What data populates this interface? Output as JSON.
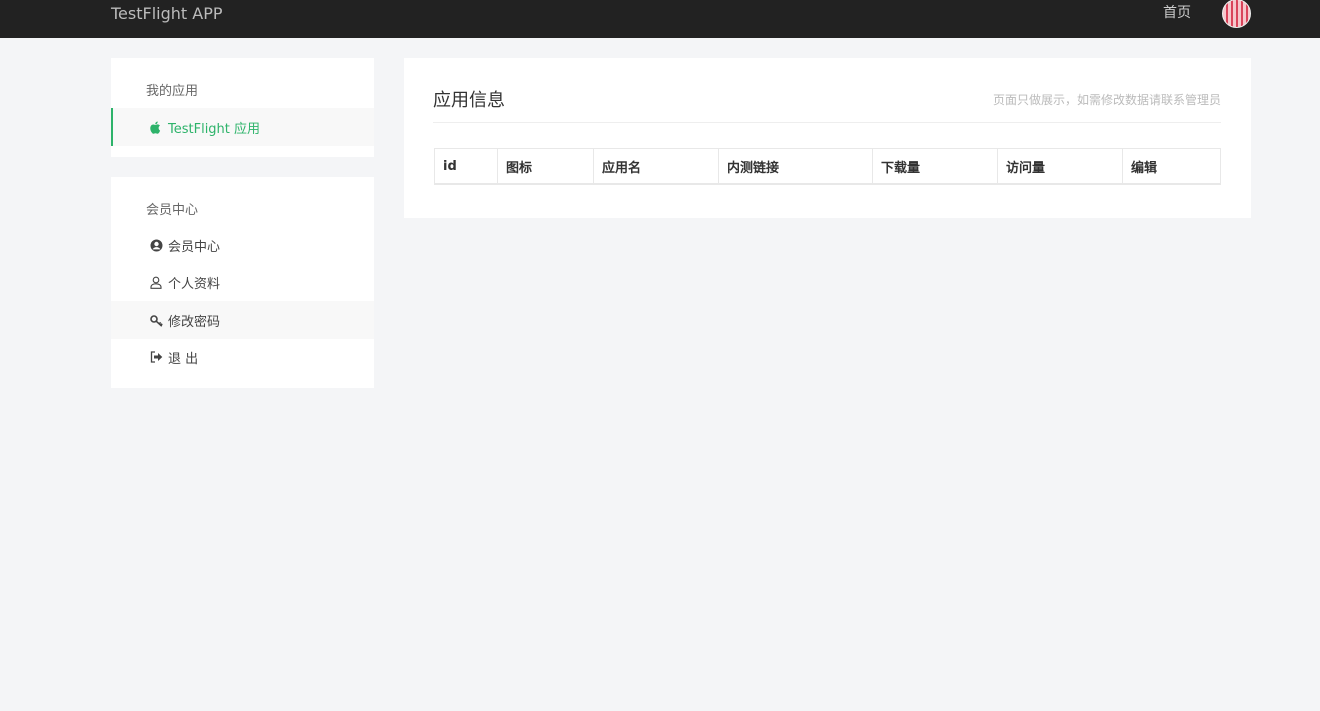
{
  "header": {
    "brand": "TestFlight APP",
    "home_link": "首页"
  },
  "sidebar": {
    "my_apps": {
      "title": "我的应用",
      "items": [
        {
          "label": "TestFlight 应用",
          "icon": "apple-icon"
        }
      ]
    },
    "member_center": {
      "title": "会员中心",
      "items": [
        {
          "label": "会员中心",
          "icon": "user-circle-icon"
        },
        {
          "label": "个人资料",
          "icon": "user-outline-icon"
        },
        {
          "label": "修改密码",
          "icon": "key-icon"
        },
        {
          "label": "退 出",
          "icon": "sign-out-icon"
        }
      ]
    }
  },
  "main": {
    "title": "应用信息",
    "note": "页面只做展示，如需修改数据请联系管理员",
    "table": {
      "columns": [
        "id",
        "图标",
        "应用名",
        "内测链接",
        "下载量",
        "访问量",
        "编辑"
      ]
    }
  },
  "colors": {
    "topbar": "#222222",
    "accent": "#2db36a",
    "background": "#f4f5f7"
  }
}
